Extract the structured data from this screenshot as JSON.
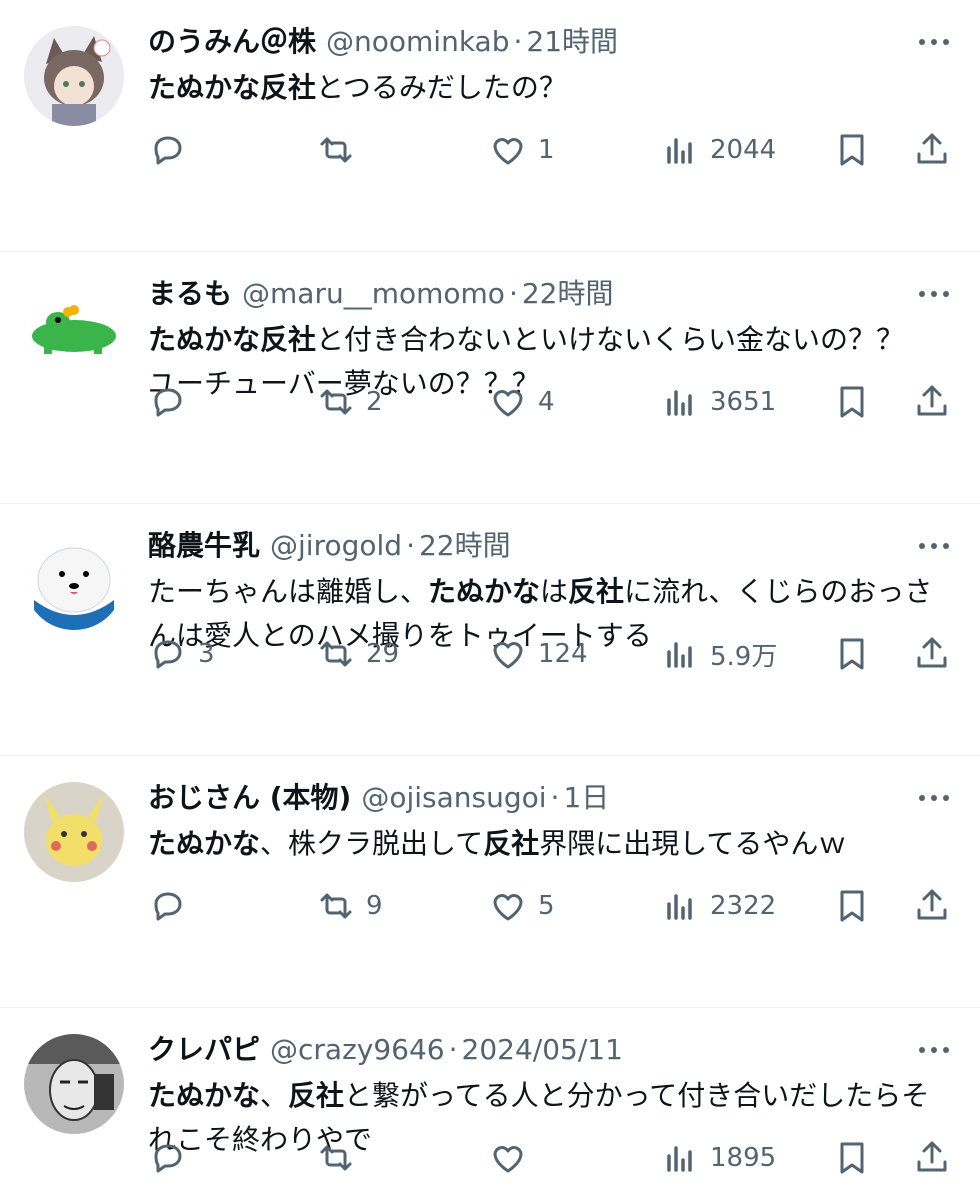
{
  "tweets": [
    {
      "name": "のうみん＠株",
      "handle": "@noominkab",
      "separator": "·",
      "time": "21時間",
      "body": [
        {
          "text": "たぬかな反社",
          "bold": true
        },
        {
          "text": "とつるみだしたの？",
          "bold": false
        }
      ],
      "replies": "",
      "retweets": "",
      "likes": "1",
      "views": "2044",
      "avatar": "anime-catgirl-avatar"
    },
    {
      "name": "まるも",
      "handle": "@maru__momomo",
      "separator": "·",
      "time": "22時間",
      "body": [
        {
          "text": "たぬかな反社",
          "bold": true
        },
        {
          "text": "と付き合わないといけないくらい金ないの？？　ユーチューバー夢ないの？？？",
          "bold": false
        }
      ],
      "replies": "",
      "retweets": "2",
      "likes": "4",
      "views": "3651",
      "avatar": "green-crocodile-avatar"
    },
    {
      "name": "酪農牛乳",
      "handle": "@jirogold",
      "separator": "·",
      "time": "22時間",
      "body": [
        {
          "text": "たーちゃんは離婚し、",
          "bold": false
        },
        {
          "text": "たぬかな",
          "bold": true
        },
        {
          "text": "は",
          "bold": false
        },
        {
          "text": "反社",
          "bold": true
        },
        {
          "text": "に流れ、くじらのおっさんは愛人とのハメ撮りをトゥイートする",
          "bold": false
        }
      ],
      "replies": "3",
      "retweets": "29",
      "likes": "124",
      "views": "5.9万",
      "avatar": "seal-avatar"
    },
    {
      "name": "おじさん (本物)",
      "handle": "@ojisansugoi",
      "separator": "·",
      "time": "1日",
      "body": [
        {
          "text": "たぬかな",
          "bold": true
        },
        {
          "text": "、株クラ脱出して",
          "bold": false
        },
        {
          "text": "反社",
          "bold": true
        },
        {
          "text": "界隈に出現してるやんｗ",
          "bold": false
        }
      ],
      "replies": "",
      "retweets": "9",
      "likes": "5",
      "views": "2322",
      "avatar": "pikachu-drawing-avatar"
    },
    {
      "name": "クレパピ",
      "handle": "@crazy9646",
      "separator": "·",
      "time": "2024/05/11",
      "body": [
        {
          "text": "たぬかな",
          "bold": true
        },
        {
          "text": "、",
          "bold": false
        },
        {
          "text": "反社",
          "bold": true
        },
        {
          "text": "と繋がってる人と分かって付き合いだしたらそれこそ終わりやで",
          "bold": false
        }
      ],
      "replies": "",
      "retweets": "",
      "likes": "",
      "views": "1895",
      "avatar": "manga-character-avatar"
    }
  ],
  "icons": {
    "reply": "reply-icon",
    "retweet": "retweet-icon",
    "like": "heart-icon",
    "views": "views-icon",
    "bookmark": "bookmark-icon",
    "share": "share-icon",
    "more": "more-icon"
  },
  "colors": {
    "text": "#0f1419",
    "secondary": "#536471",
    "divider": "#eff3f4"
  }
}
